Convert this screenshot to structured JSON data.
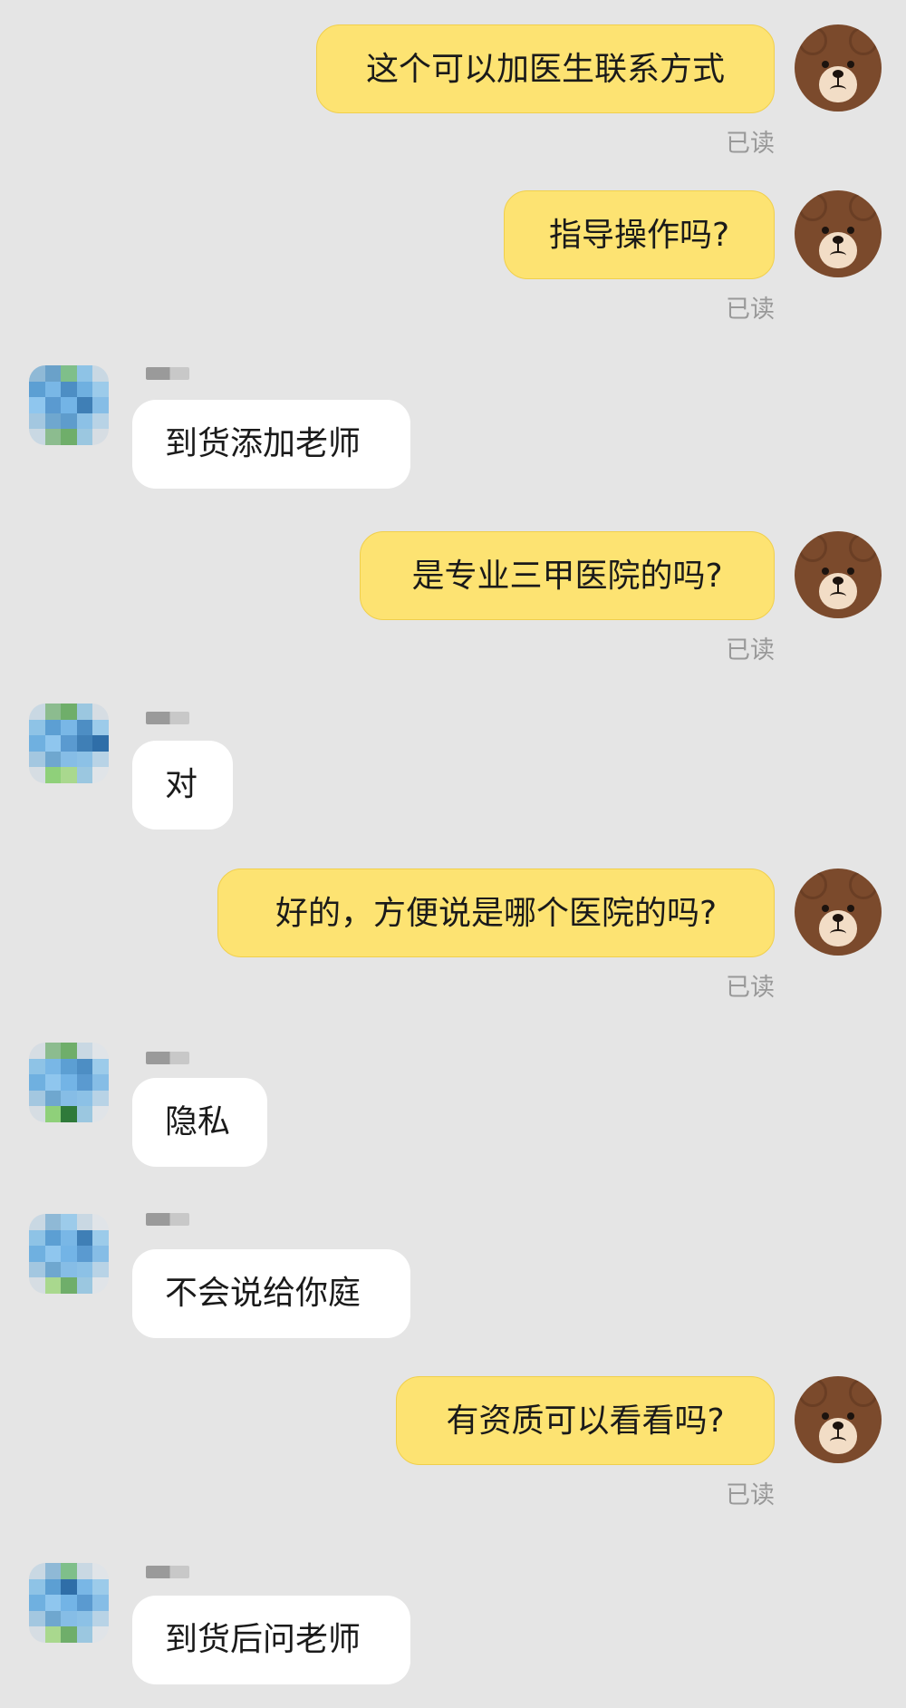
{
  "messages": [
    {
      "side": "sent",
      "text": "这个可以加医生联系方式",
      "status": "已读"
    },
    {
      "side": "sent",
      "text": "指导操作吗?",
      "status": "已读"
    },
    {
      "side": "recv",
      "text": "到货添加老师"
    },
    {
      "side": "sent",
      "text": "是专业三甲医院的吗?",
      "status": "已读"
    },
    {
      "side": "recv",
      "text": "对"
    },
    {
      "side": "sent",
      "text": "好的，方便说是哪个医院的吗?",
      "status": "已读"
    },
    {
      "side": "recv",
      "text": "隐私"
    },
    {
      "side": "recv",
      "text": "不会说给你庭"
    },
    {
      "side": "sent",
      "text": "有资质可以看看吗?",
      "status": "已读"
    },
    {
      "side": "recv",
      "text": "到货后问老师"
    }
  ],
  "colors": {
    "background": "#e5e5e5",
    "sent_bubble": "#fde372",
    "recv_bubble": "#ffffff",
    "bear": "#7b4a2c"
  },
  "icons": {
    "sent_avatar": "brown-bear-avatar",
    "recv_avatar": "pixelated-avatar"
  }
}
